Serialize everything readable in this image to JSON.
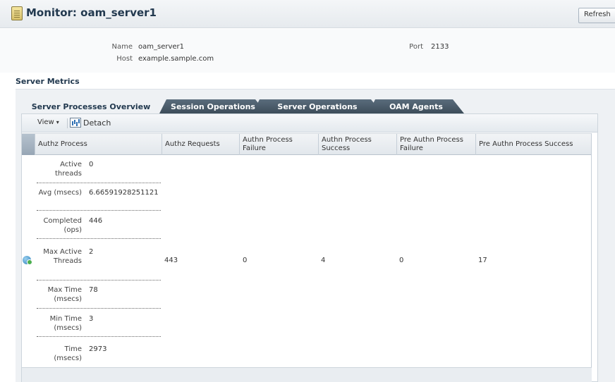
{
  "title_bar": {
    "title": "Monitor: oam_server1",
    "refresh_label": "Refresh",
    "page_icon": "server-page-icon"
  },
  "info": {
    "name_label": "Name",
    "name_value": "oam_server1",
    "host_label": "Host",
    "host_value": "example.sample.com",
    "port_label": "Port",
    "port_value": "2133"
  },
  "section_title": "Server Metrics",
  "tabs": [
    {
      "label": "Server Processes Overview",
      "active": true
    },
    {
      "label": "Session Operations",
      "active": false
    },
    {
      "label": "Server Operations",
      "active": false
    },
    {
      "label": "OAM Agents",
      "active": false
    }
  ],
  "toolbar": {
    "view_label": "View",
    "view_arrow": "▾",
    "detach_label": "Detach",
    "detach_icon": "detach-icon"
  },
  "table": {
    "columns": [
      "Authz Process",
      "Authz Requests",
      "Authn Process Failure",
      "Authn Process Success",
      "Pre Authn Process Failure",
      "Pre Authn Process Success"
    ],
    "row": {
      "status_icon": "server-status-icon",
      "authz_process": [
        {
          "label": "Active threads",
          "value": "0"
        },
        {
          "label": "Avg (msecs)",
          "value": "6.66591928251121"
        },
        {
          "label": "Completed (ops)",
          "value": "446"
        },
        {
          "label": "Max Active Threads",
          "value": "2"
        },
        {
          "label": "Max Time (msecs)",
          "value": "78"
        },
        {
          "label": "Min Time (msecs)",
          "value": "3"
        },
        {
          "label": "Time (msecs)",
          "value": "2973"
        }
      ],
      "authz_requests": "443",
      "authn_process_failure": "0",
      "authn_process_success": "4",
      "pre_authn_process_failure": "0",
      "pre_authn_process_success": "17"
    }
  }
}
